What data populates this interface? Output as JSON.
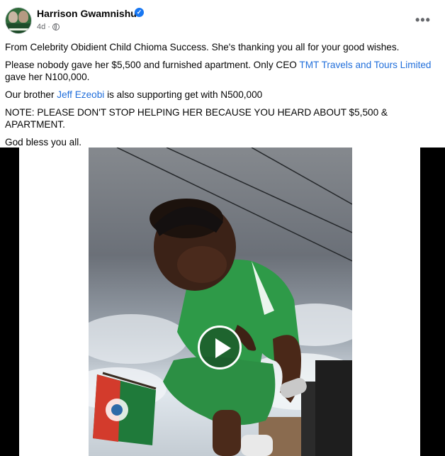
{
  "post": {
    "author": "Harrison Gwamnishu",
    "time": "4d",
    "paragraphs": [
      {
        "text": "From Celebrity Obidient Child Chioma Success. She's thanking you all for your  good wishes."
      },
      {
        "before": "Please nobody gave her $5,500 and furnished apartment. Only CEO ",
        "link": "TMT Travels and Tours Limited",
        "after": " gave her N100,000."
      },
      {
        "before": "Our brother ",
        "link": "Jeff Ezeobi",
        "after": " is also supporting get with N500,000"
      },
      {
        "text": "NOTE: PLEASE DON'T STOP HELPING HER BECAUSE YOU HEARD ABOUT $5,500 & APARTMENT."
      },
      {
        "text": "God bless you all."
      }
    ]
  },
  "icons": {
    "verified": "verified-badge-icon",
    "audience": "globe-icon",
    "menu": "more-options-icon",
    "play": "play-icon"
  },
  "colors": {
    "link": "#216fdb",
    "verified": "#1877f2",
    "meta": "#65676b"
  }
}
